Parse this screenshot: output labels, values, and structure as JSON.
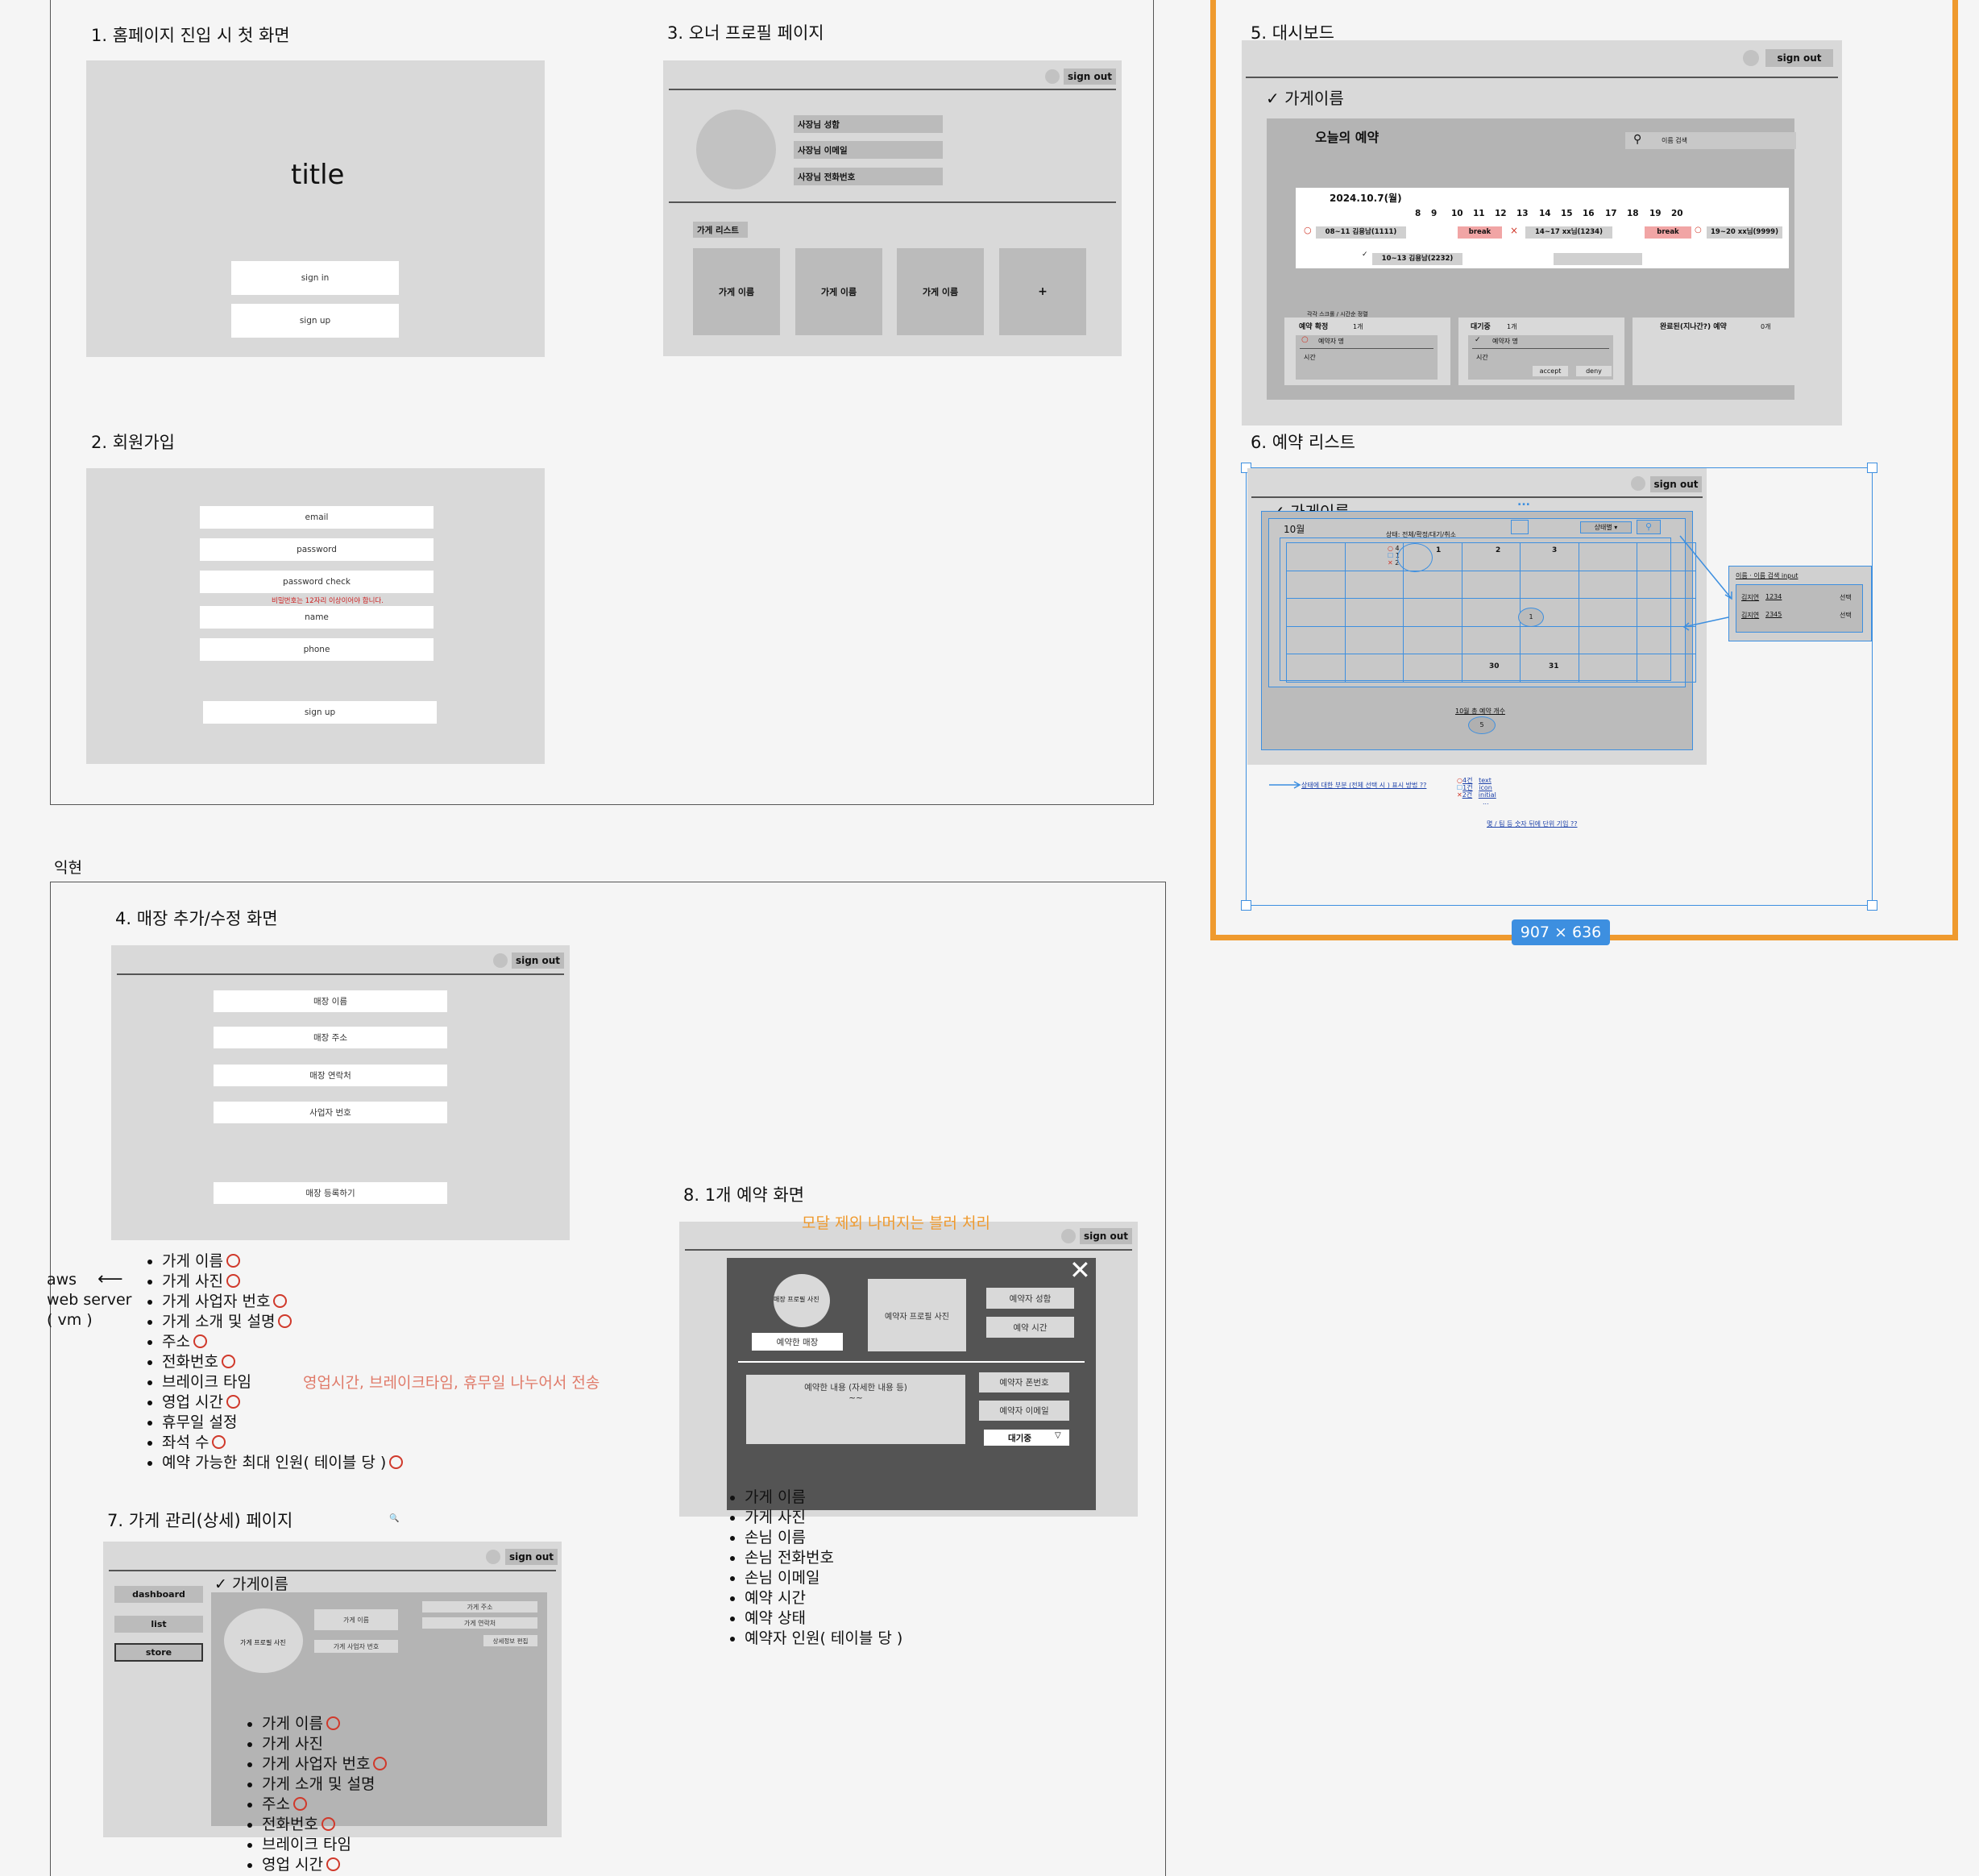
{
  "sections": {
    "s1": "1. 홈페이지 진입 시 첫 화면",
    "s2": "2. 회원가입",
    "s3": "3. 오너 프로필 페이지",
    "s4": "4. 매장 추가/수정 화면",
    "s5": "5. 대시보드",
    "s6": "6. 예약 리스트",
    "s7": "7. 가게 관리(상세) 페이지",
    "s8": "8. 1개 예약 화면",
    "author": "익현"
  },
  "home": {
    "title": "title",
    "sign_in": "sign in",
    "sign_up": "sign up"
  },
  "signup": {
    "email": "email",
    "password": "password",
    "password_check": "password check",
    "warning": "비밀번호는 12자리 이상이어야 합니다.",
    "name": "name",
    "phone": "phone",
    "submit": "sign up"
  },
  "common": {
    "sign_out": "sign out",
    "store_name": "가게이름",
    "check": "✓"
  },
  "owner": {
    "name": "사장님 성함",
    "email": "사장님 이메일",
    "phone": "사장님 전화번호",
    "store_list": "가게 리스트",
    "tile": "가게 이름",
    "add": "+"
  },
  "dashboard": {
    "today": "오늘의 예약",
    "search_placeholder": "이름 검색",
    "date": "2024.10.7(월)",
    "hours": [
      "8",
      "9",
      "10",
      "11",
      "12",
      "13",
      "14",
      "15",
      "16",
      "17",
      "18",
      "19",
      "20"
    ],
    "slot1": "08~11 김용남(1111)",
    "break": "break",
    "slot2": "14~17 xx님(1234)",
    "slot3": "19~20 xx님(9999)",
    "slot4": "10~13 김용남(2232)",
    "legend": "각각 스크롤 / 시간순 정렬",
    "confirmed": "예약 확정",
    "confirmed_count": "1개",
    "waiting": "대기중",
    "waiting_count": "1개",
    "done": "완료된(지나간?) 예약",
    "done_count": "0개",
    "booker": "예약자 명",
    "time": "시간",
    "accept": "accept",
    "deny": "deny",
    "o": "○",
    "x": "×"
  },
  "reslist": {
    "month": "10월",
    "filter_label": "상태: 전체/확정/대기/취소",
    "select": "상태별",
    "mini": [
      [
        "○",
        "4"
      ],
      [
        "☐",
        "1"
      ],
      [
        "✕",
        "2"
      ]
    ],
    "days": {
      "d1": "1",
      "d2": "2",
      "d3": "3",
      "d30": "30",
      "d31": "31",
      "circle": "1"
    },
    "total_label": "10월 총 예약 개수",
    "total": "5",
    "popup_title": "이름 · 이름 검색 input",
    "popup_rows": [
      {
        "name": "김지연",
        "num": "1234",
        "act": "선택"
      },
      {
        "name": "김지연",
        "num": "2345",
        "act": "선택"
      }
    ],
    "note1": "상태에 대한 부분 (전체 선택 시 ) 표시 방법 ??",
    "legend": [
      {
        "mark": "○",
        "text": "4건",
        "kind": "text"
      },
      {
        "mark": "☐",
        "text": "1건",
        "kind": "icon"
      },
      {
        "mark": "✕",
        "text": "2건",
        "kind": "initial"
      }
    ],
    "legend_more": "...",
    "note2": "몇 / 팀 등 숫자 뒤에 단위 기입 ??",
    "dots": "...",
    "dim": "907 × 636"
  },
  "store_form": {
    "name": "매장 이름",
    "addr": "매장 주소",
    "contact": "매장 연락처",
    "biz": "사업자 번호",
    "submit": "매장 등록하기"
  },
  "store_fields": [
    "가게 이름",
    "가게 사진",
    "가게 사업자 번호",
    "가게 소개 및 설명",
    "주소",
    "전화번호",
    "브레이크 타임",
    "영업 시간",
    "휴무일 설정",
    "좌석 수",
    "예약 가능한 최대 인원( 테이블 당 )"
  ],
  "store_marks": [
    true,
    true,
    true,
    true,
    true,
    true,
    false,
    true,
    false,
    true,
    true
  ],
  "aws": {
    "l1": "aws",
    "l2": "web server",
    "l3": "( vm )",
    "arrow": "⟵"
  },
  "note_hours": "영업시간, 브레이크타임, 휴무일 나누어서 전송",
  "store_detail": {
    "dashboard": "dashboard",
    "list": "list",
    "store": "store",
    "photo": "가게 프로필 사진",
    "name": "가게 이름",
    "biz": "가게 사업자 번호",
    "addr": "가게 주소",
    "contact": "가게 연락처",
    "edit": "상세정보 편집",
    "search": "🔍"
  },
  "detail_fields": [
    "가게 이름",
    "가게 사진",
    "가게 사업자 번호",
    "가게 소개 및 설명",
    "주소",
    "전화번호",
    "브레이크 타임",
    "영업 시간"
  ],
  "detail_marks": [
    true,
    false,
    true,
    false,
    true,
    true,
    false,
    true
  ],
  "single": {
    "blur_note": "모달 제외 나머지는 블러 처리",
    "store_photo": "매장 프로필 사진",
    "reserved_store": "예약한 매장",
    "booker_photo": "예약자 프로필 사진",
    "booker_name": "예약자 성함",
    "time": "예약 시간",
    "content": "예약한 내용 (자세한 내용 등)",
    "tilde": "~~",
    "phone": "예약자 폰번호",
    "email": "예약자 이메일",
    "status": "대기중",
    "close": "✕"
  },
  "single_fields": [
    "가게 이름",
    "가게 사진",
    "손님 이름",
    "손님 전화번호",
    "손님 이메일",
    "예약 시간",
    "예약 상태",
    "예약자 인원( 테이블 당 )"
  ],
  "colors": {
    "orange": "#ef9a2e",
    "blue": "#3d8fe0",
    "break": "#f1a5a5",
    "note": "#e07b6a",
    "modal": "#545454"
  }
}
